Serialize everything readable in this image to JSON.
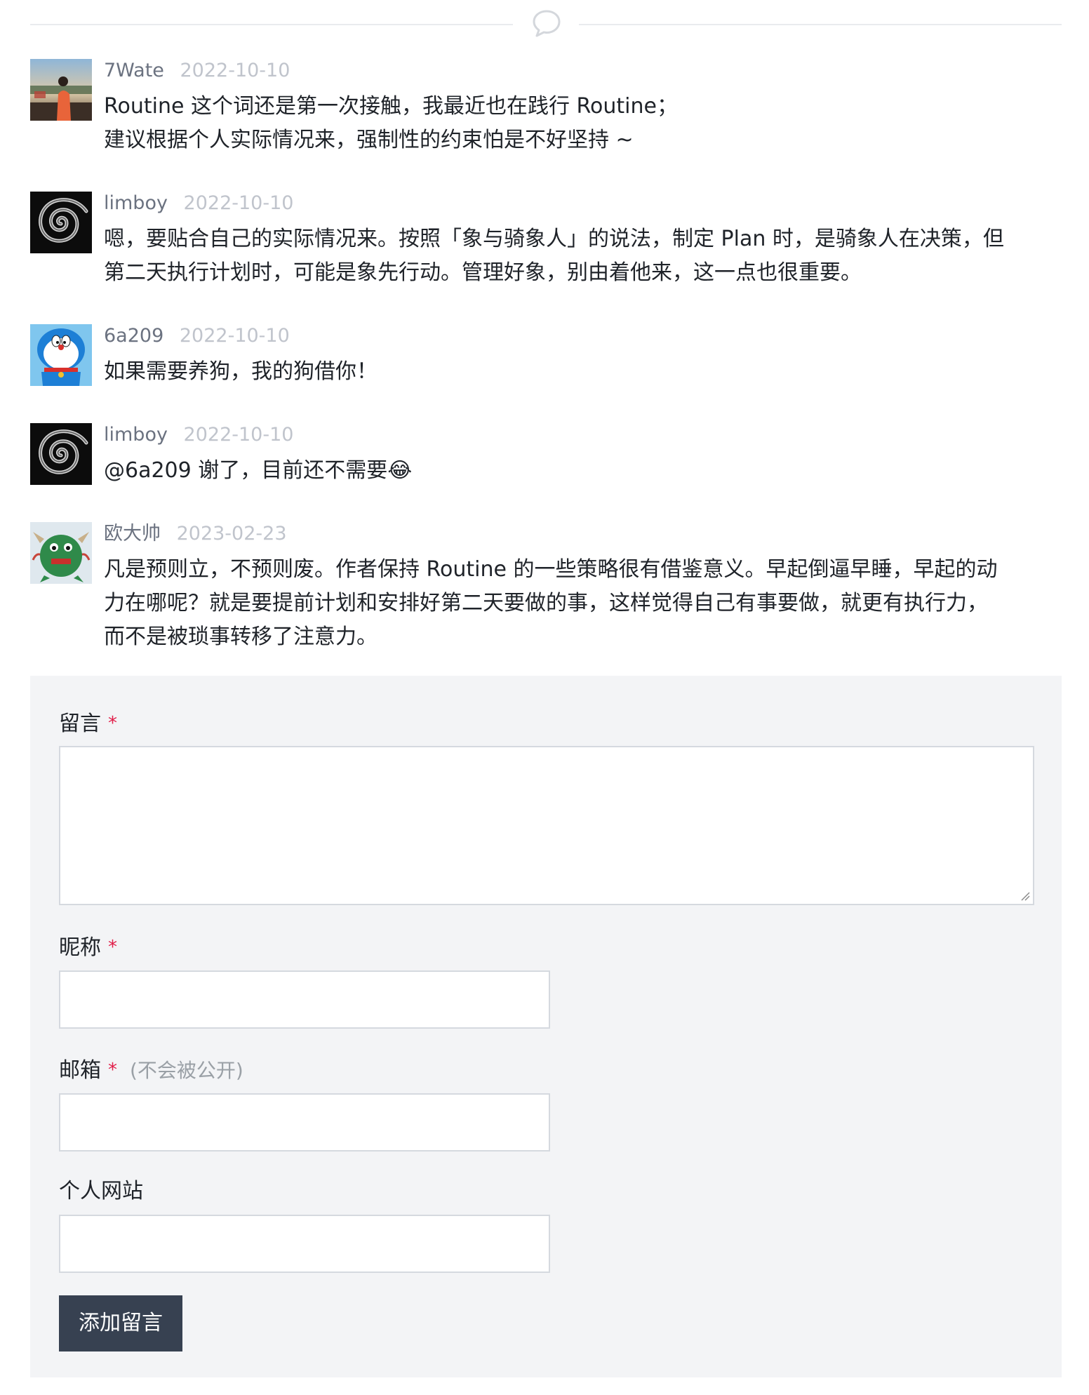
{
  "divider": {
    "icon": "comment-bubble-icon"
  },
  "comments": [
    {
      "author": "7Wate",
      "date": "2022-10-10",
      "avatar": "photo-person-sunset",
      "lines": [
        "Routine 这个词还是第一次接触，我最近也在践行 Routine；",
        "建议根据个人实际情况来，强制性的约束怕是不好坚持 ~"
      ]
    },
    {
      "author": "limboy",
      "date": "2022-10-10",
      "avatar": "black-spiral",
      "lines": [
        "嗯，要贴合自己的实际情况来。按照「象与骑象人」的说法，制定 Plan 时，是骑象人在决策，但",
        "第二天执行计划时，可能是象先行动。管理好象，别由着他来，这一点也很重要。"
      ]
    },
    {
      "author": "6a209",
      "date": "2022-10-10",
      "avatar": "doraemon",
      "lines": [
        "如果需要养狗，我的狗借你！"
      ]
    },
    {
      "author": "limboy",
      "date": "2022-10-10",
      "avatar": "black-spiral",
      "lines": [
        "@6a209 谢了，目前还不需要😂"
      ]
    },
    {
      "author": "欧大帅",
      "date": "2023-02-23",
      "avatar": "green-monster",
      "lines": [
        "凡是预则立，不预则废。作者保持 Routine 的一些策略很有借鉴意义。早起倒逼早睡，早起的动",
        "力在哪呢？就是要提前计划和安排好第二天要做的事，这样觉得自己有事要做，就更有执行力，",
        "而不是被琐事转移了注意力。"
      ]
    }
  ],
  "form": {
    "message_label": "留言",
    "nickname_label": "昵称",
    "email_label": "邮箱",
    "email_note": "(不会被公开)",
    "website_label": "个人网站",
    "required_mark": "*",
    "submit_label": "添加留言",
    "message_value": "",
    "nickname_value": "",
    "email_value": "",
    "website_value": ""
  },
  "colors": {
    "form_background": "#f3f4f6",
    "button_background": "#374151",
    "required_star": "#e11d48"
  }
}
